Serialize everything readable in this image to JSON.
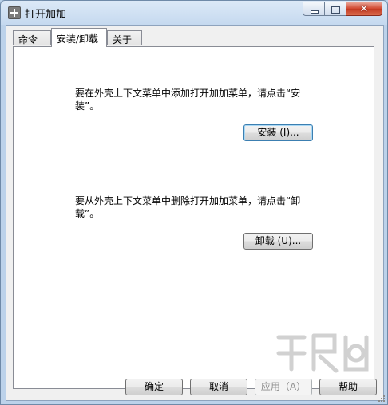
{
  "window": {
    "title": "打开加加"
  },
  "caption": {
    "min_icon": "minimize-icon",
    "max_icon": "maximize-icon",
    "close_glyph": "✕"
  },
  "tabs": [
    {
      "label": "命令",
      "active": false
    },
    {
      "label": "安装/卸载",
      "active": true
    },
    {
      "label": "关于",
      "active": false
    }
  ],
  "install": {
    "message": "要在外壳上下文菜单中添加打开加加菜单，请点击“安装”。",
    "button": "安装 (I)..."
  },
  "uninstall": {
    "message": "要从外壳上下文菜单中删除打开加加菜单，请点击“卸载”。",
    "button": "卸载 (U)..."
  },
  "footer": {
    "ok": "确定",
    "cancel": "取消",
    "apply": "应用（A）",
    "help": "帮助"
  },
  "colors": {
    "accent": "#3c7fb1",
    "close": "#c23a22",
    "frame": "#bcd2ea"
  }
}
